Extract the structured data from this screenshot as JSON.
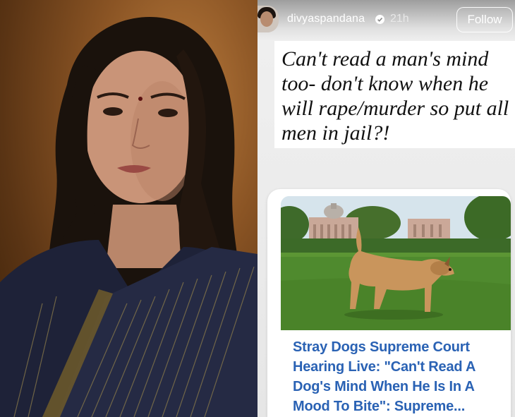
{
  "story": {
    "username": "divyaspandana",
    "timestamp": "21h",
    "follow_label": "Follow",
    "verified_icon": "verified-badge-icon",
    "quote": "Can't read a man's mind too- don't know when he will rape/murder so put all men in jail?!"
  },
  "article": {
    "headline": "Stray Dogs Supreme Court Hearing Live: \"Can't Read A Dog's Mind When He Is In A Mood To Bite\": Supreme..."
  },
  "colors": {
    "headline_blue": "#2a62b4",
    "portrait_background": "#8a5424",
    "saree_navy": "#1e2238",
    "lawn_green": "#4f8a2e"
  }
}
